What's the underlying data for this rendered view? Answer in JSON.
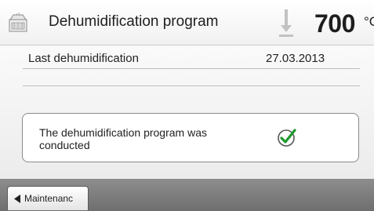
{
  "header": {
    "title": "Dehumidification program",
    "temperature": "700",
    "temperature_unit": "°C",
    "icons": {
      "furnace": "furnace-icon",
      "temperature": "temperature-arrow-icon"
    }
  },
  "info": {
    "rows": [
      {
        "label": "Last dehumidification",
        "value": "27.03.2013"
      }
    ]
  },
  "status": {
    "message": "The dehumidification program was conducted",
    "icon": "checkmark-icon"
  },
  "footer": {
    "back_label": "Maintenanc",
    "back_icon": "left-arrow-icon"
  },
  "colors": {
    "check_green": "#1f9a2f",
    "footer_bar": "#7d7d7d"
  }
}
